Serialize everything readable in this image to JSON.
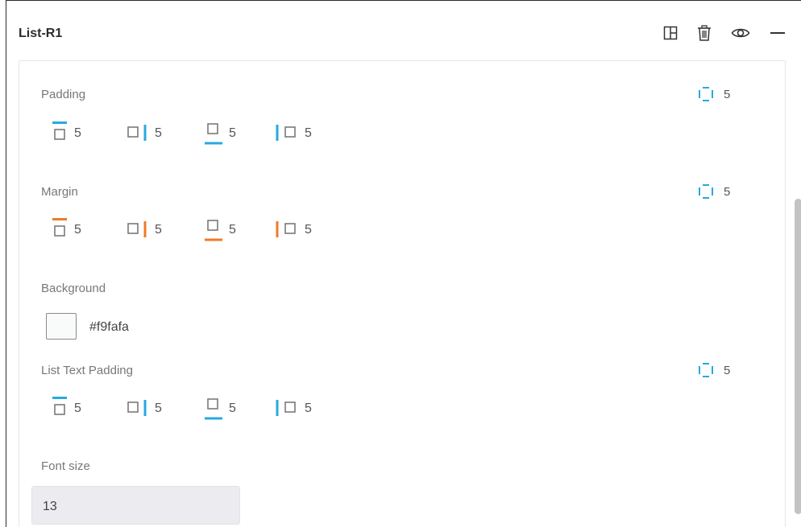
{
  "header": {
    "title": "List-R1",
    "icons": [
      "layout-icon",
      "trash-icon",
      "eye-icon",
      "minimize-icon"
    ]
  },
  "colors": {
    "padding_accent": "#29a8e0",
    "margin_accent": "#f07a28",
    "box_grey": "#7a7a7a"
  },
  "padding": {
    "label": "Padding",
    "all": "5",
    "top": "5",
    "right": "5",
    "bottom": "5",
    "left": "5"
  },
  "margin": {
    "label": "Margin",
    "all": "5",
    "top": "5",
    "right": "5",
    "bottom": "5",
    "left": "5"
  },
  "background": {
    "label": "Background",
    "color": "#f9fafa",
    "hex": "#f9fafa"
  },
  "list_text_padding": {
    "label": "List Text Padding",
    "all": "5",
    "top": "5",
    "right": "5",
    "bottom": "5",
    "left": "5"
  },
  "font_size": {
    "label": "Font size",
    "value": "13"
  }
}
